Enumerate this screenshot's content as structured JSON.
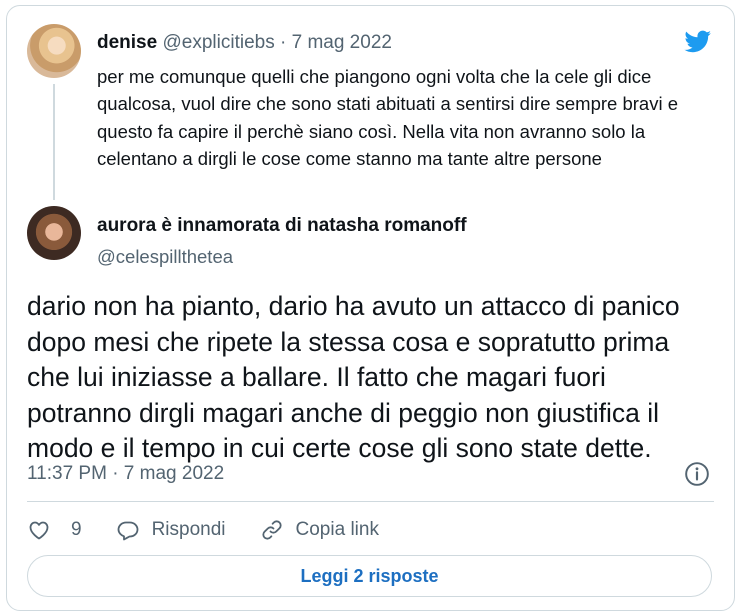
{
  "quoted": {
    "name": "denise",
    "handle": "@explicitiebs",
    "separator": " · ",
    "date": "7 mag 2022",
    "text": "per me comunque quelli che piangono ogni volta che la cele gli dice qualcosa, vuol dire che sono stati abituati a sentirsi dire sempre bravi e questo fa capire il perchè siano così. Nella vita non avranno solo la celentano a dirgli le cose come stanno ma tante altre persone"
  },
  "main": {
    "name": "aurora è innamorata di natasha romanoff",
    "handle": "@celespillthetea",
    "text": "dario non ha pianto, dario ha avuto un attacco di panico dopo mesi che ripete la stessa cosa e sopratutto prima che lui iniziasse a ballare. Il fatto che magari fuori potranno dirgli magari anche di peggio non giustifica il modo e il tempo in cui certe cose gli sono state dette.",
    "timestamp": "11:37 PM · 7 mag 2022"
  },
  "actions": {
    "like_count": "9",
    "reply_label": "Rispondi",
    "copy_label": "Copia link"
  },
  "footer": {
    "read_replies_label": "Leggi 2 risposte"
  },
  "colors": {
    "brand": "#1d9bf0",
    "link": "#1d6fc1",
    "secondary_text": "#536471",
    "border": "#cfd9de"
  },
  "icons": [
    "twitter-bird-icon",
    "info-icon",
    "heart-icon",
    "reply-bubble-icon",
    "link-icon"
  ]
}
